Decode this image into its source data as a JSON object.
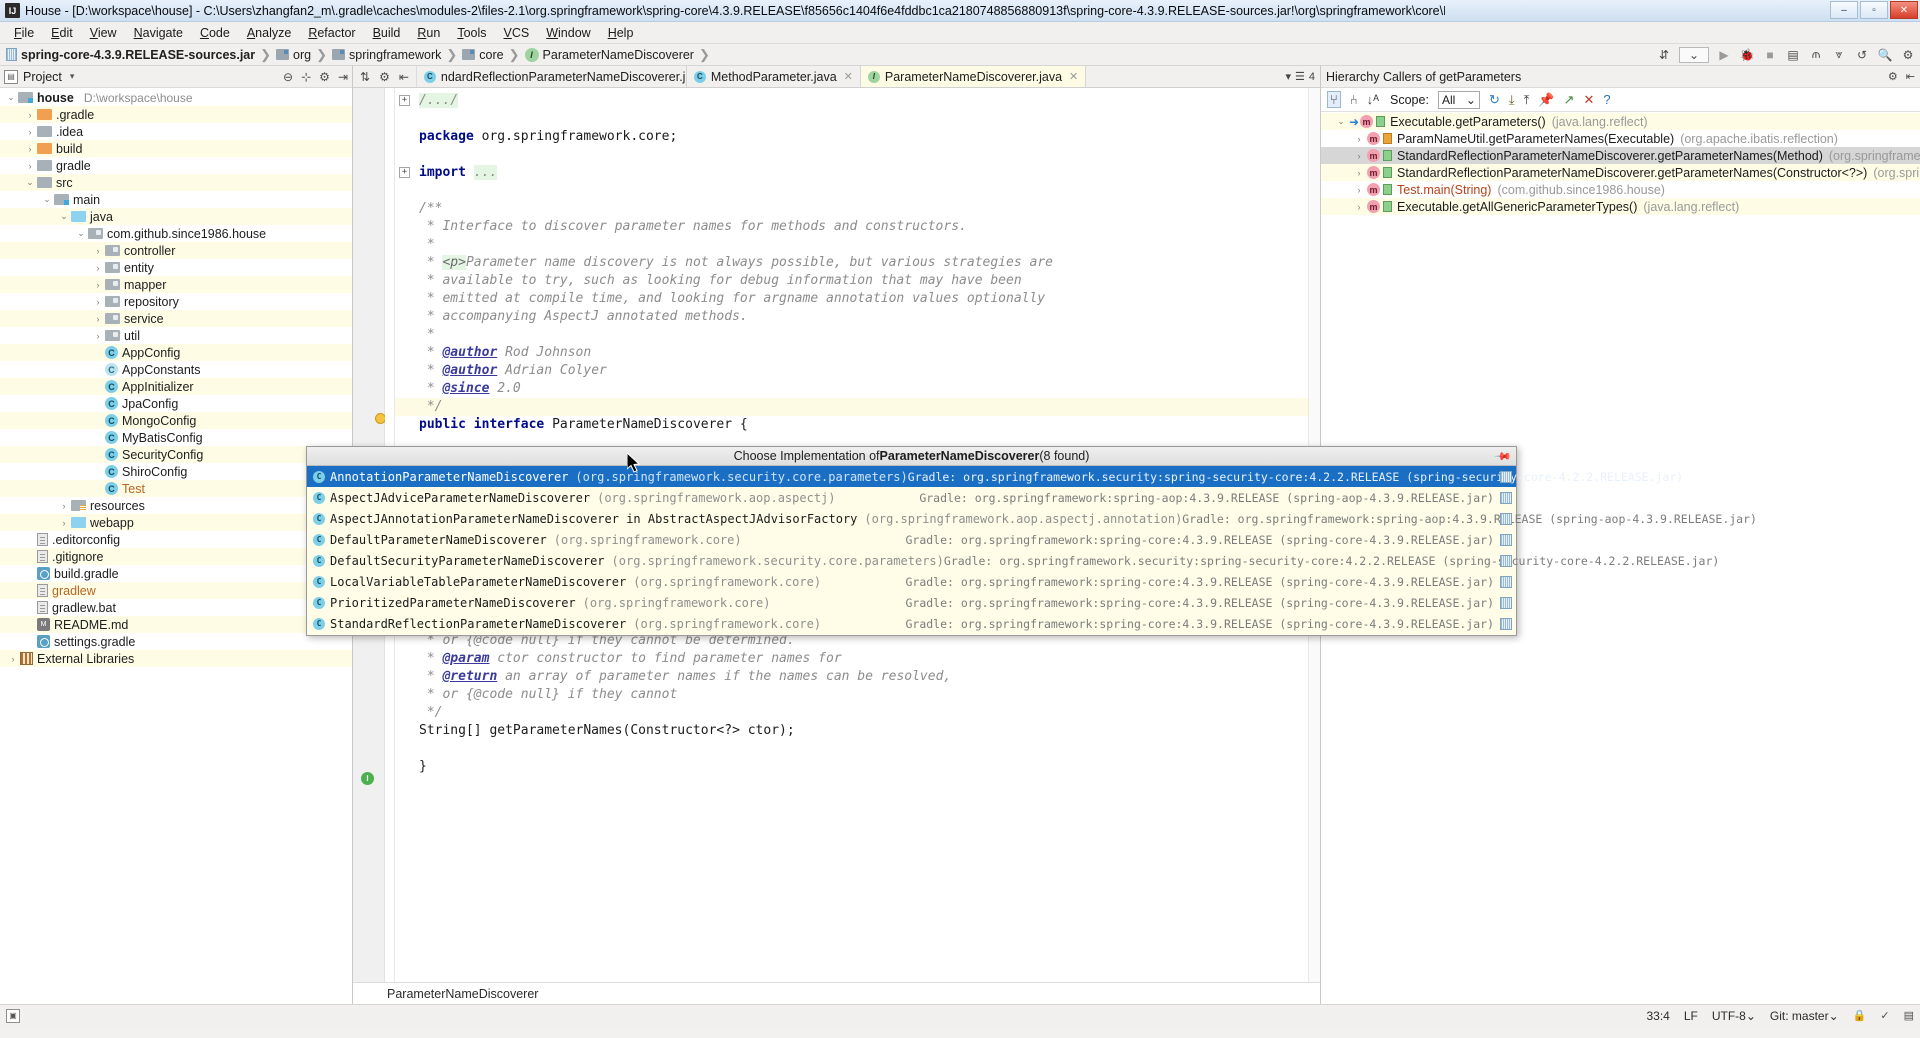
{
  "window": {
    "title": "House - [D:\\workspace\\house] - C:\\Users\\zhangfan2_m\\.gradle\\caches\\modules-2\\files-2.1\\org.springframework\\spring-core\\4.3.9.RELEASE\\f85656c1404f6e4fddbc1ca2180748856880913f\\spring-core-4.3.9.RELEASE-sources.jar!\\org\\springframework\\core\\ParameterNameDisc",
    "logo": "IJ",
    "minimize": "–",
    "maximize": "▫",
    "close": "✕"
  },
  "menu": [
    "File",
    "Edit",
    "View",
    "Navigate",
    "Code",
    "Analyze",
    "Refactor",
    "Build",
    "Run",
    "Tools",
    "VCS",
    "Window",
    "Help"
  ],
  "navbar": {
    "crumbs": [
      {
        "label": "spring-core-4.3.9.RELEASE-sources.jar",
        "icon": "jar-icon",
        "bold": true
      },
      {
        "label": "org",
        "icon": "folder-icon",
        "bold": false
      },
      {
        "label": "springframework",
        "icon": "folder-icon",
        "bold": false
      },
      {
        "label": "core",
        "icon": "folder-icon",
        "bold": false
      },
      {
        "label": "ParameterNameDiscoverer",
        "icon": "interface-icon",
        "bold": false
      }
    ],
    "right_icons": [
      "download-icon",
      "chevron-down-icon",
      "run-icon",
      "debug-icon",
      "stop-icon",
      "layout-icon",
      "coverage-icon",
      "profile-icon",
      "undo-icon",
      "search-icon",
      "settings-icon"
    ]
  },
  "project_panel": {
    "header_title": "Project",
    "header_icon": "project-icon",
    "caret": "▾",
    "tools": [
      "collapse-icon",
      "target-icon",
      "gear-icon",
      "hide-icon"
    ],
    "root": {
      "label": "house",
      "path": "D:\\workspace\\house"
    },
    "items": [
      {
        "depth": 1,
        "arrow": "›",
        "icon": "folder-orange",
        "label": ".gradle",
        "alt": true
      },
      {
        "depth": 1,
        "arrow": "›",
        "icon": "folder",
        "label": ".idea",
        "alt": false
      },
      {
        "depth": 1,
        "arrow": "›",
        "icon": "folder-orange",
        "label": "build",
        "alt": true
      },
      {
        "depth": 1,
        "arrow": "›",
        "icon": "folder",
        "label": "gradle",
        "alt": false
      },
      {
        "depth": 1,
        "arrow": "⌄",
        "icon": "folder",
        "label": "src",
        "alt": true
      },
      {
        "depth": 2,
        "arrow": "⌄",
        "icon": "folder-src",
        "label": "main",
        "alt": false
      },
      {
        "depth": 3,
        "arrow": "⌄",
        "icon": "folder-blue",
        "label": "java",
        "alt": true
      },
      {
        "depth": 4,
        "arrow": "⌄",
        "icon": "package",
        "label": "com.github.since1986.house",
        "alt": false
      },
      {
        "depth": 5,
        "arrow": "›",
        "icon": "package",
        "label": "controller",
        "alt": true
      },
      {
        "depth": 5,
        "arrow": "›",
        "icon": "package",
        "label": "entity",
        "alt": false
      },
      {
        "depth": 5,
        "arrow": "›",
        "icon": "package",
        "label": "mapper",
        "alt": true
      },
      {
        "depth": 5,
        "arrow": "›",
        "icon": "package",
        "label": "repository",
        "alt": false
      },
      {
        "depth": 5,
        "arrow": "›",
        "icon": "package",
        "label": "service",
        "alt": true
      },
      {
        "depth": 5,
        "arrow": "›",
        "icon": "package",
        "label": "util",
        "alt": false
      },
      {
        "depth": 5,
        "arrow": "",
        "icon": "class",
        "label": "AppConfig",
        "alt": true
      },
      {
        "depth": 5,
        "arrow": "",
        "icon": "class-abstract",
        "label": "AppConstants",
        "alt": false
      },
      {
        "depth": 5,
        "arrow": "",
        "icon": "class",
        "label": "AppInitializer",
        "alt": true
      },
      {
        "depth": 5,
        "arrow": "",
        "icon": "class",
        "label": "JpaConfig",
        "alt": false
      },
      {
        "depth": 5,
        "arrow": "",
        "icon": "class",
        "label": "MongoConfig",
        "alt": true
      },
      {
        "depth": 5,
        "arrow": "",
        "icon": "class",
        "label": "MyBatisConfig",
        "alt": false
      },
      {
        "depth": 5,
        "arrow": "",
        "icon": "class",
        "label": "SecurityConfig",
        "alt": true
      },
      {
        "depth": 5,
        "arrow": "",
        "icon": "class",
        "label": "ShiroConfig",
        "alt": false
      },
      {
        "depth": 5,
        "arrow": "",
        "icon": "class",
        "label": "Test",
        "alt": true,
        "color": "orange"
      },
      {
        "depth": 3,
        "arrow": "›",
        "icon": "folder-res",
        "label": "resources",
        "alt": false
      },
      {
        "depth": 3,
        "arrow": "›",
        "icon": "folder-blue",
        "label": "webapp",
        "alt": true
      },
      {
        "depth": 1,
        "arrow": "",
        "icon": "file",
        "label": ".editorconfig",
        "alt": false
      },
      {
        "depth": 1,
        "arrow": "",
        "icon": "file",
        "label": ".gitignore",
        "alt": true
      },
      {
        "depth": 1,
        "arrow": "",
        "icon": "gradle",
        "label": "build.gradle",
        "alt": false
      },
      {
        "depth": 1,
        "arrow": "",
        "icon": "file",
        "label": "gradlew",
        "alt": true,
        "color": "orange"
      },
      {
        "depth": 1,
        "arrow": "",
        "icon": "file",
        "label": "gradlew.bat",
        "alt": false
      },
      {
        "depth": 1,
        "arrow": "",
        "icon": "md",
        "label": "README.md",
        "alt": true
      },
      {
        "depth": 1,
        "arrow": "",
        "icon": "gradle",
        "label": "settings.gradle",
        "alt": false
      },
      {
        "depth": 0,
        "arrow": "›",
        "icon": "libs",
        "label": "External Libraries",
        "alt": true
      }
    ]
  },
  "editor": {
    "tool_icons": [
      "sort-icon",
      "gear-icon",
      "locate-icon"
    ],
    "tabs": [
      {
        "label": "ndardReflectionParameterNameDiscoverer.java",
        "icon": "class-icon",
        "active": false,
        "close": "✕"
      },
      {
        "label": "MethodParameter.java",
        "icon": "class-icon",
        "active": false,
        "close": "✕"
      },
      {
        "label": "ParameterNameDiscoverer.java",
        "icon": "interface-icon",
        "active": true,
        "close": "✕"
      }
    ],
    "tab_overflow": "4",
    "status_text": "ParameterNameDiscoverer",
    "lines": [
      {
        "type": "fold",
        "text": "/.../",
        "hl": false
      },
      {
        "type": "blank",
        "text": "",
        "hl": false
      },
      {
        "type": "code",
        "text": "package org.springframework.core;",
        "hl": false
      },
      {
        "type": "blank",
        "text": "",
        "hl": false
      },
      {
        "type": "import",
        "text": "import ...",
        "hl": false
      },
      {
        "type": "blank",
        "text": "",
        "hl": false
      },
      {
        "type": "comment",
        "text": "/**",
        "hl": false
      },
      {
        "type": "comment",
        "text": " * Interface to discover parameter names for methods and constructors.",
        "hl": false
      },
      {
        "type": "comment",
        "text": " *",
        "hl": false
      },
      {
        "type": "comment-p",
        "text": " * <p>Parameter name discovery is not always possible, but various strategies are",
        "hl": false
      },
      {
        "type": "comment",
        "text": " * available to try, such as looking for debug information that may have been",
        "hl": false
      },
      {
        "type": "comment",
        "text": " * emitted at compile time, and looking for argname annotation values optionally",
        "hl": false
      },
      {
        "type": "comment",
        "text": " * accompanying AspectJ annotated methods.",
        "hl": false
      },
      {
        "type": "comment",
        "text": " *",
        "hl": false
      },
      {
        "type": "author",
        "text": " * @author Rod Johnson",
        "hl": false
      },
      {
        "type": "author",
        "text": " * @author Adrian Colyer",
        "hl": false
      },
      {
        "type": "since",
        "text": " * @since 2.0",
        "hl": false
      },
      {
        "type": "comment",
        "text": " */",
        "hl": true
      },
      {
        "type": "decl",
        "text": "public interface ParameterNameDiscoverer {",
        "hl": false
      }
    ],
    "lines_below": [
      {
        "type": "comment",
        "text": " * or {@code null} if they cannot be determined."
      },
      {
        "type": "param",
        "text": " * @param ctor constructor to find parameter names for"
      },
      {
        "type": "return",
        "text": " * @return an array of parameter names if the names can be resolved,"
      },
      {
        "type": "comment",
        "text": " * or {@code null} if they cannot"
      },
      {
        "type": "comment",
        "text": " */"
      },
      {
        "type": "code",
        "text": "String[] getParameterNames(Constructor<?> ctor);"
      },
      {
        "type": "blank",
        "text": ""
      },
      {
        "type": "code2",
        "text": "}"
      }
    ]
  },
  "hierarchy": {
    "header": "Hierarchy Callers of getParameters",
    "header_icons": [
      "gear-icon",
      "hide-icon"
    ],
    "toolbar": {
      "icons": [
        "subtypes-icon",
        "supertypes-icon",
        "sort-alpha-icon"
      ],
      "scope_label": "Scope:",
      "scope_value": "All",
      "scope_caret": "⌄",
      "right_icons": [
        "refresh-icon",
        "export-icon",
        "collapse-icon",
        "pin-icon",
        "open-icon",
        "close-icon",
        "help-icon"
      ]
    },
    "rows": [
      {
        "arrow": "⌄",
        "indent": 0,
        "icon": "method-icon",
        "entry": true,
        "vis": "public",
        "name": "Executable.getParameters()",
        "pkg": "(java.lang.reflect)",
        "alt": true,
        "selected": false
      },
      {
        "arrow": "›",
        "indent": 1,
        "icon": "method-icon",
        "entry": false,
        "vis": "lock",
        "name": "ParamNameUtil.getParameterNames(Executable)",
        "pkg": "(org.apache.ibatis.reflection)",
        "alt": false,
        "selected": false
      },
      {
        "arrow": "›",
        "indent": 1,
        "icon": "method-icon",
        "entry": false,
        "vis": "public",
        "name": "StandardReflectionParameterNameDiscoverer.getParameterNames(Method)",
        "pkg": "(org.springframework.core)",
        "alt": false,
        "selected": true
      },
      {
        "arrow": "›",
        "indent": 1,
        "icon": "method-icon",
        "entry": false,
        "vis": "public",
        "name": "StandardReflectionParameterNameDiscoverer.getParameterNames(Constructor<?>)",
        "pkg": "(org.springframework.core)",
        "alt": true,
        "selected": false
      },
      {
        "arrow": "›",
        "indent": 1,
        "icon": "method-icon",
        "entry": false,
        "vis": "public",
        "name": "Test.main(String)",
        "pkg": "(com.github.since1986.house)",
        "alt": false,
        "selected": false,
        "color": "red"
      },
      {
        "arrow": "›",
        "indent": 1,
        "icon": "method-icon",
        "entry": false,
        "vis": "public",
        "name": "Executable.getAllGenericParameterTypes()",
        "pkg": "(java.lang.reflect)",
        "alt": true,
        "selected": false
      }
    ]
  },
  "popup": {
    "title_prefix": "Choose Implementation of ",
    "title_target": "ParameterNameDiscoverer",
    "title_suffix": " (8 found)",
    "pin_icon": "pin-icon",
    "rows": [
      {
        "name": "AnnotationParameterNameDiscoverer",
        "pkg": "(org.springframework.security.core.parameters)",
        "gradle": "Gradle: org.springframework.security:spring-security-core:4.2.2.RELEASE (spring-security-core-4.2.2.RELEASE.jar)",
        "selected": true
      },
      {
        "name": "AspectJAdviceParameterNameDiscoverer",
        "pkg": "(org.springframework.aop.aspectj)",
        "gradle": "Gradle: org.springframework:spring-aop:4.3.9.RELEASE (spring-aop-4.3.9.RELEASE.jar)",
        "selected": false
      },
      {
        "name": "AspectJAnnotationParameterNameDiscoverer in AbstractAspectJAdvisorFactory",
        "pkg": "(org.springframework.aop.aspectj.annotation)",
        "gradle": "Gradle: org.springframework:spring-aop:4.3.9.RELEASE (spring-aop-4.3.9.RELEASE.jar)",
        "selected": false
      },
      {
        "name": "DefaultParameterNameDiscoverer",
        "pkg": "(org.springframework.core)",
        "gradle": "Gradle: org.springframework:spring-core:4.3.9.RELEASE (spring-core-4.3.9.RELEASE.jar)",
        "selected": false
      },
      {
        "name": "DefaultSecurityParameterNameDiscoverer",
        "pkg": "(org.springframework.security.core.parameters)",
        "gradle": "Gradle: org.springframework.security:spring-security-core:4.2.2.RELEASE (spring-security-core-4.2.2.RELEASE.jar)",
        "selected": false
      },
      {
        "name": "LocalVariableTableParameterNameDiscoverer",
        "pkg": "(org.springframework.core)",
        "gradle": "Gradle: org.springframework:spring-core:4.3.9.RELEASE (spring-core-4.3.9.RELEASE.jar)",
        "selected": false
      },
      {
        "name": "PrioritizedParameterNameDiscoverer",
        "pkg": "(org.springframework.core)",
        "gradle": "Gradle: org.springframework:spring-core:4.3.9.RELEASE (spring-core-4.3.9.RELEASE.jar)",
        "selected": false
      },
      {
        "name": "StandardReflectionParameterNameDiscoverer",
        "pkg": "(org.springframework.core)",
        "gradle": "Gradle: org.springframework:spring-core:4.3.9.RELEASE (spring-core-4.3.9.RELEASE.jar)",
        "selected": false
      }
    ]
  },
  "statusbar": {
    "caret_position": "33:4",
    "line_separator": "LF",
    "encoding": "UTF-8",
    "encoding_caret": "⌄",
    "git_branch": "Git: master",
    "git_caret": "⌄",
    "right_icons": [
      "lock-icon",
      "inspection-icon",
      "memory-icon"
    ]
  },
  "colors": {
    "accent_blue": "#1a6fc4",
    "selection_bg": "#d4e7fb",
    "highlight_yellow": "#fffce6",
    "popup_bg": "#fffde8"
  }
}
